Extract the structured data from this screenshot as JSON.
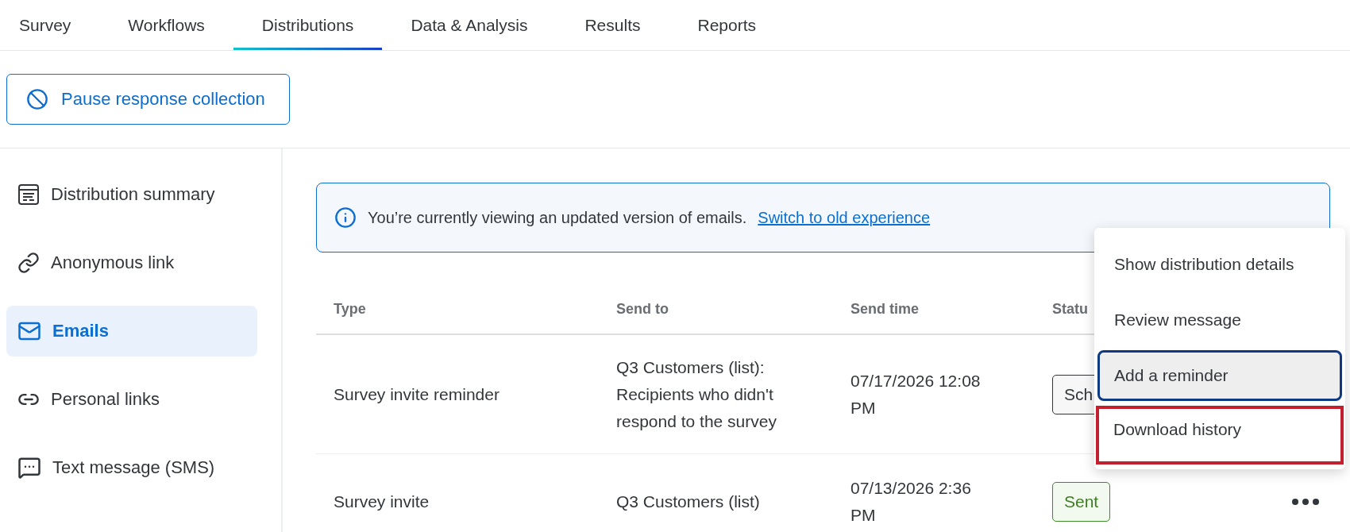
{
  "tabs": [
    {
      "label": "Survey",
      "selected": false
    },
    {
      "label": "Workflows",
      "selected": false
    },
    {
      "label": "Distributions",
      "selected": true
    },
    {
      "label": "Data & Analysis",
      "selected": false
    },
    {
      "label": "Results",
      "selected": false
    },
    {
      "label": "Reports",
      "selected": false
    }
  ],
  "pause_button": {
    "label": "Pause response collection"
  },
  "sidebar": {
    "items": [
      {
        "label": "Distribution summary",
        "kind": "summary",
        "selected": false
      },
      {
        "label": "Anonymous link",
        "kind": "link",
        "selected": false
      },
      {
        "label": "Emails",
        "kind": "mail",
        "selected": true
      },
      {
        "label": "Personal links",
        "kind": "personal",
        "selected": false
      },
      {
        "label": "Text message (SMS)",
        "kind": "sms",
        "selected": false
      }
    ]
  },
  "banner": {
    "text": "You’re currently viewing an updated version of emails.",
    "link": "Switch to old experience"
  },
  "table": {
    "columns": [
      "Type",
      "Send to",
      "Send time",
      "Statu"
    ],
    "rows": [
      {
        "type": "Survey invite reminder",
        "send_to": "Q3 Customers (list): Recipients who didn't respond to the survey",
        "send_time": "07/17/2026 12:08 PM",
        "status": "Sch",
        "kind": "scheduled",
        "show_actions": false
      },
      {
        "type": "Survey invite",
        "send_to": "Q3 Customers (list)",
        "send_time": "07/13/2026 2:36 PM",
        "status": "Sent",
        "kind": "sent",
        "show_actions": true
      }
    ]
  },
  "menu": {
    "items": [
      {
        "label": "Show distribution details",
        "focused": false,
        "highlighted": false
      },
      {
        "label": "Review message",
        "focused": false,
        "highlighted": false
      },
      {
        "label": "Add a reminder",
        "focused": true,
        "highlighted": false
      },
      {
        "label": "Download history",
        "focused": false,
        "highlighted": true
      }
    ]
  }
}
